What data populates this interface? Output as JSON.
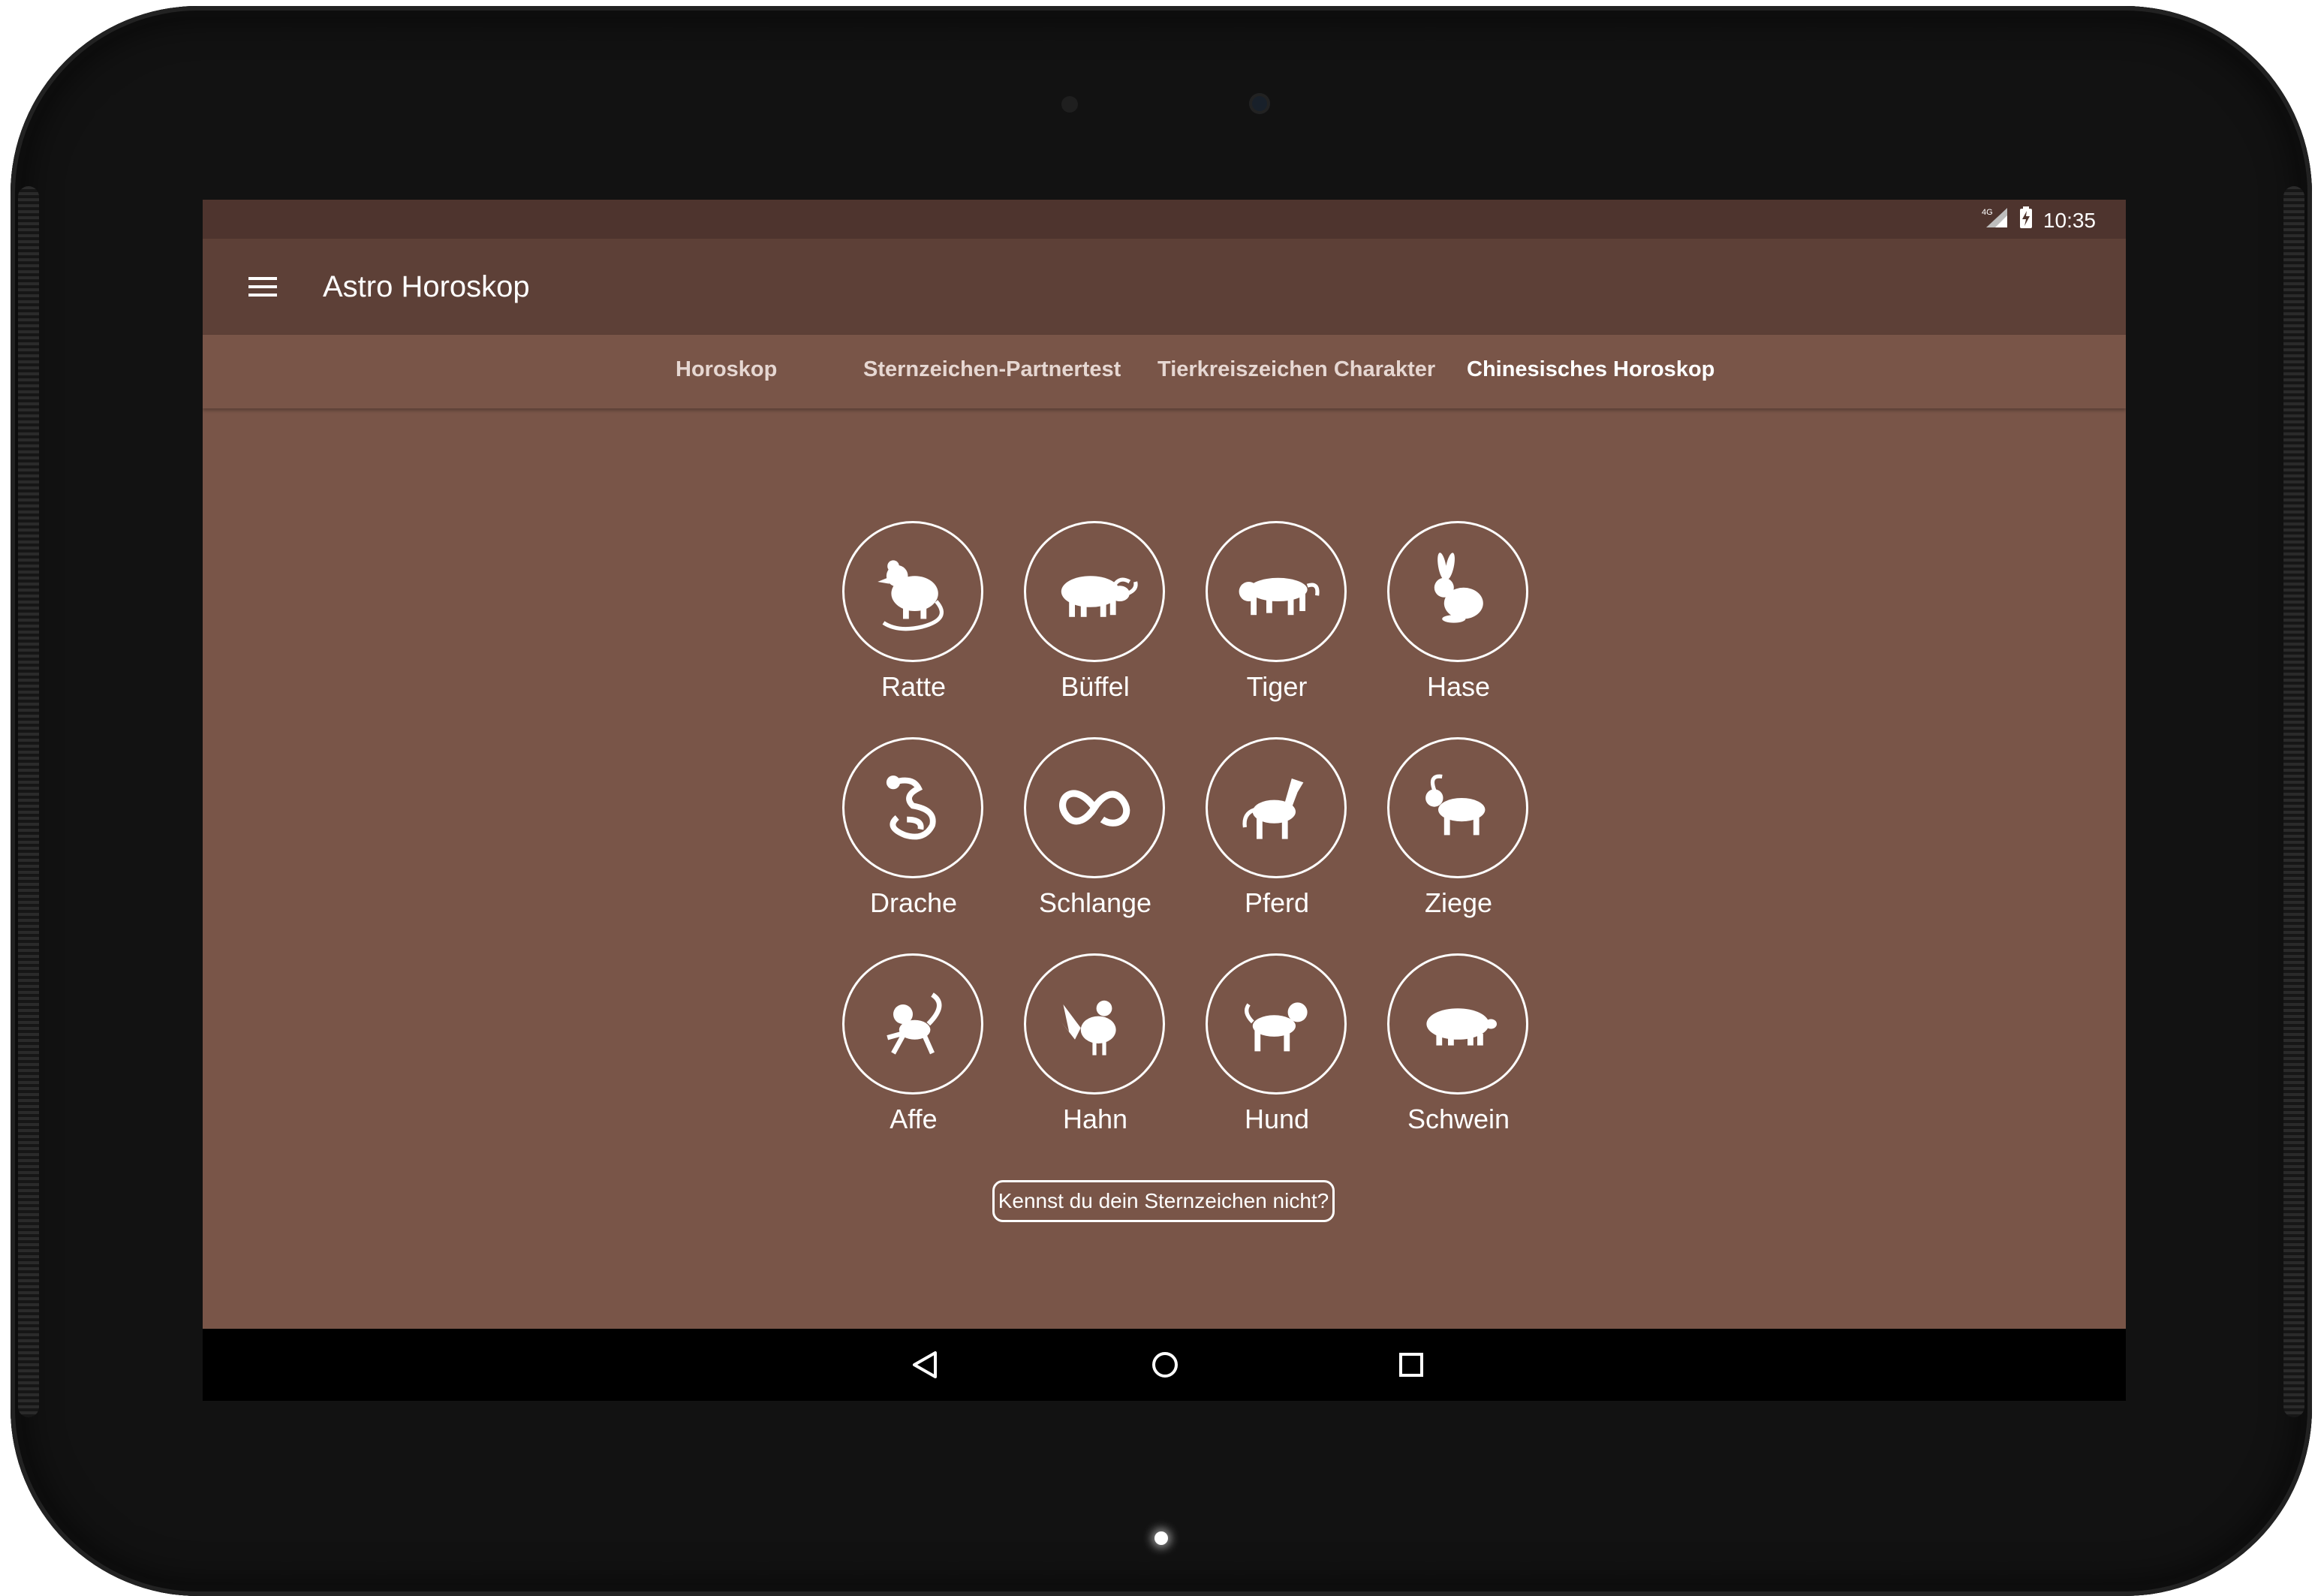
{
  "status_bar": {
    "network": "4G",
    "time": "10:35"
  },
  "app": {
    "title": "Astro Horoskop"
  },
  "tabs": [
    {
      "label": "Horoskop",
      "active": false
    },
    {
      "label": "Sternzeichen-Partnertest",
      "active": false
    },
    {
      "label": "Tierkreiszeichen Charakter",
      "active": false
    },
    {
      "label": "Chinesisches Horoskop",
      "active": true
    }
  ],
  "signs": [
    {
      "label": "Ratte",
      "icon": "rat-icon"
    },
    {
      "label": "Büffel",
      "icon": "buffalo-icon"
    },
    {
      "label": "Tiger",
      "icon": "tiger-icon"
    },
    {
      "label": "Hase",
      "icon": "rabbit-icon"
    },
    {
      "label": "Drache",
      "icon": "dragon-icon"
    },
    {
      "label": "Schlange",
      "icon": "snake-icon"
    },
    {
      "label": "Pferd",
      "icon": "horse-icon"
    },
    {
      "label": "Ziege",
      "icon": "goat-icon"
    },
    {
      "label": "Affe",
      "icon": "monkey-icon"
    },
    {
      "label": "Hahn",
      "icon": "rooster-icon"
    },
    {
      "label": "Hund",
      "icon": "dog-icon"
    },
    {
      "label": "Schwein",
      "icon": "pig-icon"
    }
  ],
  "know_button": {
    "label": "Kennst du dein Sternzeichen nicht?"
  },
  "colors": {
    "status_bar": "#4e342e",
    "toolbar": "#5d4037",
    "content_bg": "#795548",
    "navbar": "#000000",
    "text": "#ffffff"
  }
}
